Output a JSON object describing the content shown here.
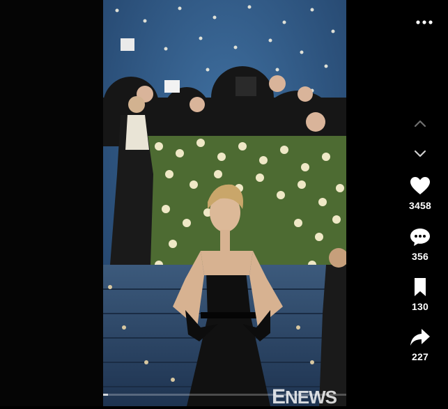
{
  "menu": {
    "more_icon": "more-horizontal-icon"
  },
  "navigation": {
    "up_icon": "chevron-up-icon",
    "down_icon": "chevron-down-icon"
  },
  "actions": {
    "like": {
      "icon": "heart-icon",
      "count": "3458"
    },
    "comment": {
      "icon": "comment-bubble-icon",
      "count": "356"
    },
    "save": {
      "icon": "bookmark-icon",
      "count": "130"
    },
    "share": {
      "icon": "share-arrow-icon",
      "count": "227"
    }
  },
  "video": {
    "watermark_big": "E",
    "watermark_rest": "NEWS",
    "progress_fraction": 0.02
  },
  "colors": {
    "background": "#000000",
    "icon": "#ffffff",
    "backdrop": "#2b4f78"
  }
}
